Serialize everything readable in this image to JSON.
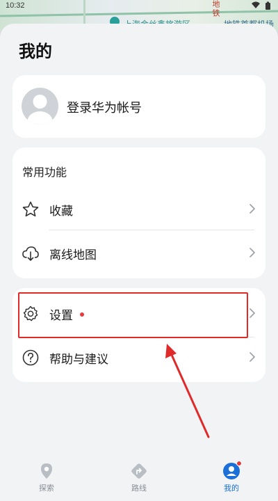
{
  "status_bar": {
    "time": "10:32"
  },
  "map": {
    "place_label": "上海金丝鑫旅游区",
    "metro_label": "地铁首都机场",
    "vertical_text": "地铁"
  },
  "page": {
    "title": "我的"
  },
  "account": {
    "label": "登录华为帐号"
  },
  "common": {
    "title": "常用功能",
    "items": [
      {
        "label": "收藏",
        "icon": "star-icon"
      },
      {
        "label": "离线地图",
        "icon": "cloud-download-icon"
      }
    ]
  },
  "settings_group": {
    "items": [
      {
        "label": "设置",
        "icon": "gear-icon",
        "has_dot": true
      },
      {
        "label": "帮助与建议",
        "icon": "question-icon"
      }
    ]
  },
  "bottom_nav": {
    "items": [
      {
        "label": "探索",
        "icon": "location-pin-icon",
        "active": false
      },
      {
        "label": "路线",
        "icon": "route-icon",
        "active": false
      },
      {
        "label": "我的",
        "icon": "profile-icon",
        "active": true
      }
    ]
  },
  "colors": {
    "accent": "#1a6fd8",
    "highlight": "#e02a2a",
    "badge": "#e8393d"
  }
}
